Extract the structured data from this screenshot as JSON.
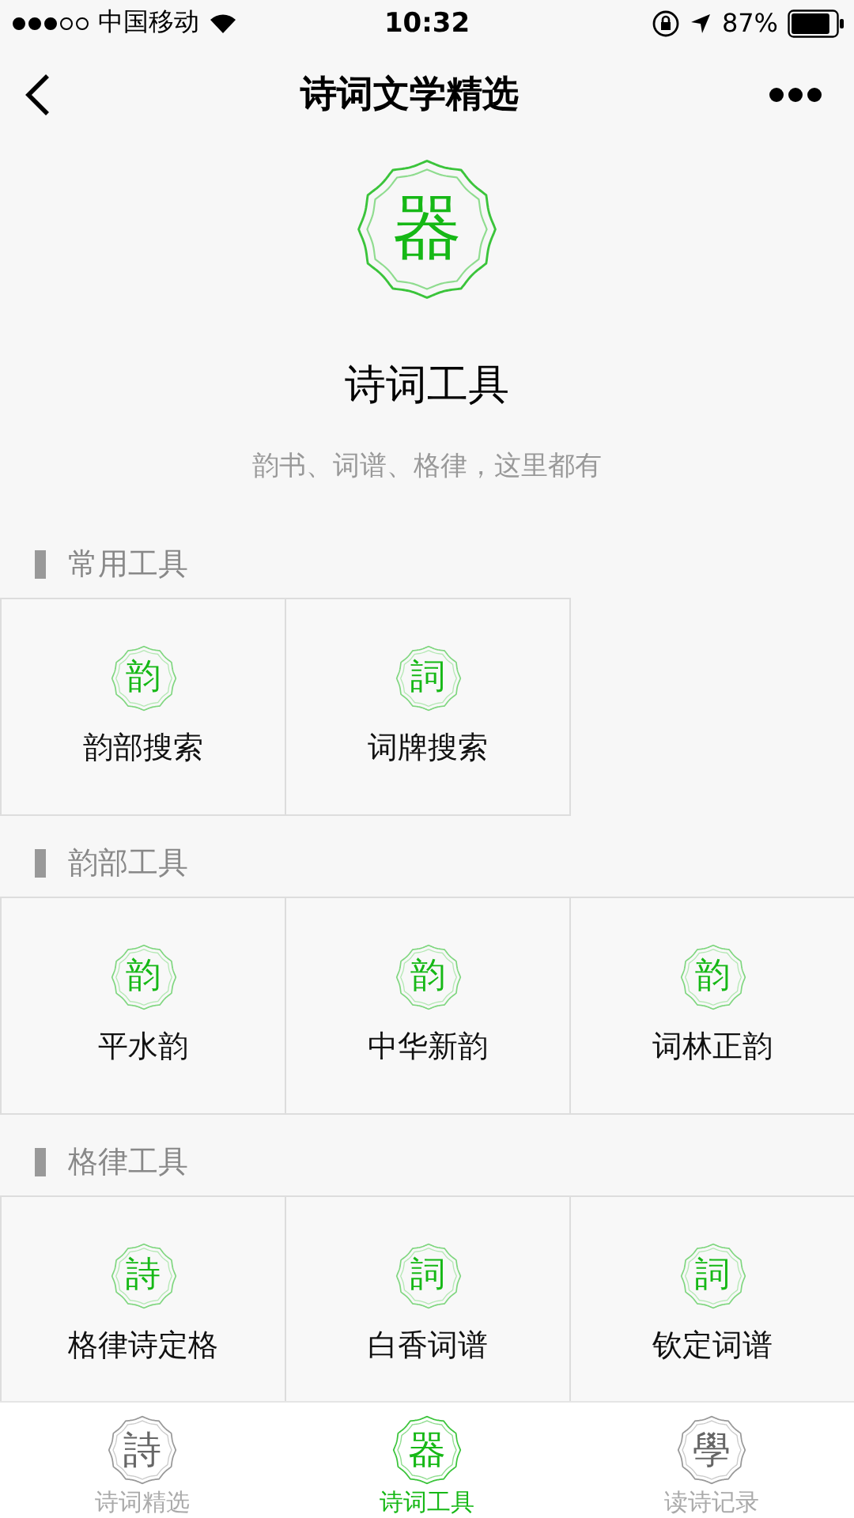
{
  "status_bar": {
    "carrier": "中国移动",
    "time": "10:32",
    "battery": "87%"
  },
  "nav": {
    "title": "诗词文学精选"
  },
  "header": {
    "glyph": "器",
    "title": "诗词工具",
    "subtitle": "韵书、词谱、格律，这里都有"
  },
  "sections": [
    {
      "title": "常用工具",
      "items": [
        {
          "glyph": "韵",
          "label": "韵部搜索"
        },
        {
          "glyph": "詞",
          "label": "词牌搜索"
        }
      ]
    },
    {
      "title": "韵部工具",
      "items": [
        {
          "glyph": "韵",
          "label": "平水韵"
        },
        {
          "glyph": "韵",
          "label": "中华新韵"
        },
        {
          "glyph": "韵",
          "label": "词林正韵"
        }
      ]
    },
    {
      "title": "格律工具",
      "items": [
        {
          "glyph": "詩",
          "label": "格律诗定格"
        },
        {
          "glyph": "詞",
          "label": "白香词谱"
        },
        {
          "glyph": "詞",
          "label": "钦定词谱"
        }
      ]
    }
  ],
  "tab_bar": [
    {
      "glyph": "詩",
      "label": "诗词精选",
      "selected": false
    },
    {
      "glyph": "器",
      "label": "诗词工具",
      "selected": true
    },
    {
      "glyph": "學",
      "label": "读诗记录",
      "selected": false
    }
  ]
}
